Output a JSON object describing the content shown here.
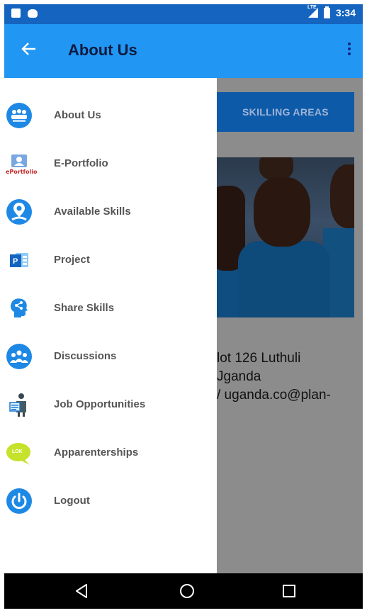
{
  "status_bar": {
    "time": "3:34",
    "network_label": "LTE"
  },
  "app_bar": {
    "title": "About Us"
  },
  "background": {
    "skilling_button": "SKILLING AREAS",
    "address_lines": [
      "lot 126 Luthuli",
      "Jganda",
      "/ uganda.co@plan-"
    ]
  },
  "drawer": {
    "items": [
      {
        "label": "About Us",
        "icon": "about-us-icon"
      },
      {
        "label": "E-Portfolio",
        "icon": "eportfolio-icon",
        "icon_text": "ePortfolio"
      },
      {
        "label": "Available Skills",
        "icon": "location-pin-icon"
      },
      {
        "label": "Project",
        "icon": "project-icon",
        "icon_text": "P"
      },
      {
        "label": "Share Skills",
        "icon": "share-head-icon"
      },
      {
        "label": "Discussions",
        "icon": "group-icon"
      },
      {
        "label": "Job Opportunities",
        "icon": "job-icon"
      },
      {
        "label": "Apparenterships",
        "icon": "chat-bubble-icon",
        "icon_text": "LOK"
      },
      {
        "label": "Logout",
        "icon": "power-icon"
      }
    ]
  },
  "colors": {
    "primary": "#2196f3",
    "status": "#1565c0",
    "button": "#0d5aa8"
  }
}
